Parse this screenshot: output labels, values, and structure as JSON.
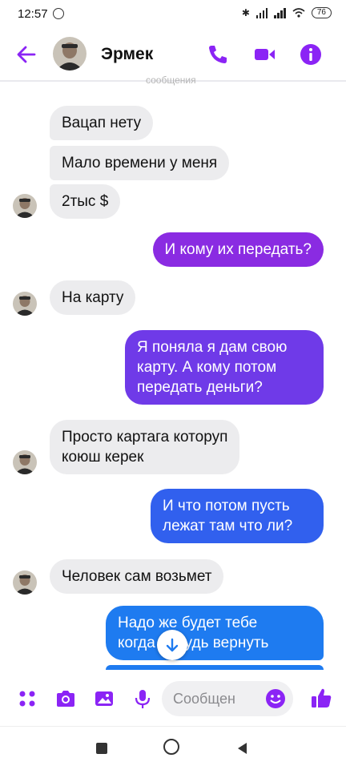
{
  "status_bar": {
    "time": "12:57",
    "battery": "76"
  },
  "header": {
    "contact_name": "Эрмек",
    "cut_text": "сообщения"
  },
  "messages": [
    {
      "text": "Вацап нету"
    },
    {
      "text": "Мало времени у меня"
    },
    {
      "text": "2тыс $"
    },
    {
      "text": "И кому их передать?"
    },
    {
      "text": "На карту"
    },
    {
      "line1": "Я поняла я дам свою",
      "line2": "карту. А кому потом",
      "line3": "передать деньги?"
    },
    {
      "line1": "Просто картага которуп",
      "line2": "коюш керек"
    },
    {
      "line1": "И что потом пусть",
      "line2": "лежат там что ли?"
    },
    {
      "text": "Человек сам возьмет"
    },
    {
      "line1": "Надо же будет тебе",
      "line2": "когда нибудь вернуть"
    }
  ],
  "composer": {
    "placeholder": "Сообщен"
  },
  "colors": {
    "accent": "#8b24f5",
    "bubble_in": "#ececee",
    "outgoing_top": "#8a2be2",
    "outgoing_bottom": "#1e7bf0"
  },
  "icons": [
    "back-arrow-icon",
    "phone-icon",
    "video-icon",
    "info-icon",
    "apps-icon",
    "camera-icon",
    "gallery-icon",
    "microphone-icon",
    "emoji-icon",
    "thumbs-up-icon",
    "scroll-down-icon",
    "nav-square-icon",
    "nav-home-icon",
    "nav-back-icon"
  ]
}
